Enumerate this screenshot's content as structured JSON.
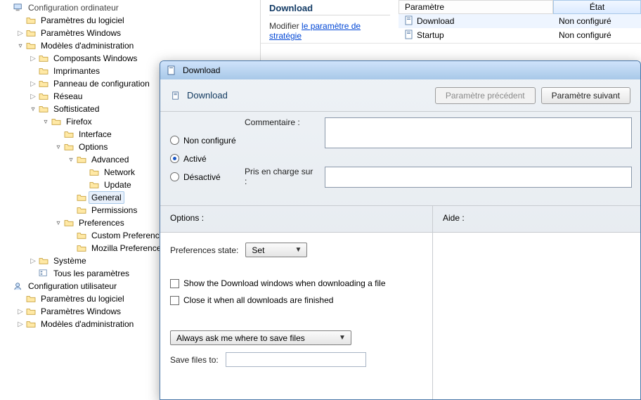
{
  "tree": {
    "config_ord": "Configuration ordinateur",
    "param_log1": "Paramètres du logiciel",
    "param_win1": "Paramètres Windows",
    "modeles1": "Modèles d'administration",
    "comp_win": "Composants Windows",
    "imprimantes": "Imprimantes",
    "panneau": "Panneau de configuration",
    "reseau": "Réseau",
    "softisticated": "Softisticated",
    "firefox": "Firefox",
    "interface": "Interface",
    "options": "Options",
    "advanced": "Advanced",
    "network": "Network",
    "update": "Update",
    "general": "General",
    "permissions": "Permissions",
    "preferences": "Preferences",
    "custom_pref": "Custom Preferences",
    "mozilla_pref": "Mozilla Preferences",
    "systeme": "Système",
    "tous_param": "Tous les paramètres",
    "config_user": "Configuration utilisateur",
    "param_log2": "Paramètres du logiciel",
    "param_win2": "Paramètres Windows",
    "modeles2": "Modèles d'administration"
  },
  "main": {
    "head_title": "Download",
    "modifier": "Modifier",
    "link": "le paramètre de stratégie",
    "col_param": "Paramètre",
    "col_state": "État",
    "rows": [
      {
        "name": "Download",
        "state": "Non configuré"
      },
      {
        "name": "Startup",
        "state": "Non configuré"
      }
    ]
  },
  "dialog": {
    "title": "Download",
    "heading": "Download",
    "btn_prev": "Paramètre précédent",
    "btn_next": "Paramètre suivant",
    "radio_nc": "Non configuré",
    "radio_on": "Activé",
    "radio_off": "Désactivé",
    "comment_label": "Commentaire :",
    "support_label": "Pris en charge sur :",
    "options_label": "Options :",
    "aide_label": "Aide :",
    "pref_state_label": "Preferences state:",
    "pref_state_value": "Set",
    "chk1": "Show the Download windows when downloading a file",
    "chk2": "Close it when all downloads are finished",
    "ask_where": "Always ask me where to save files",
    "save_to": "Save files to:"
  }
}
